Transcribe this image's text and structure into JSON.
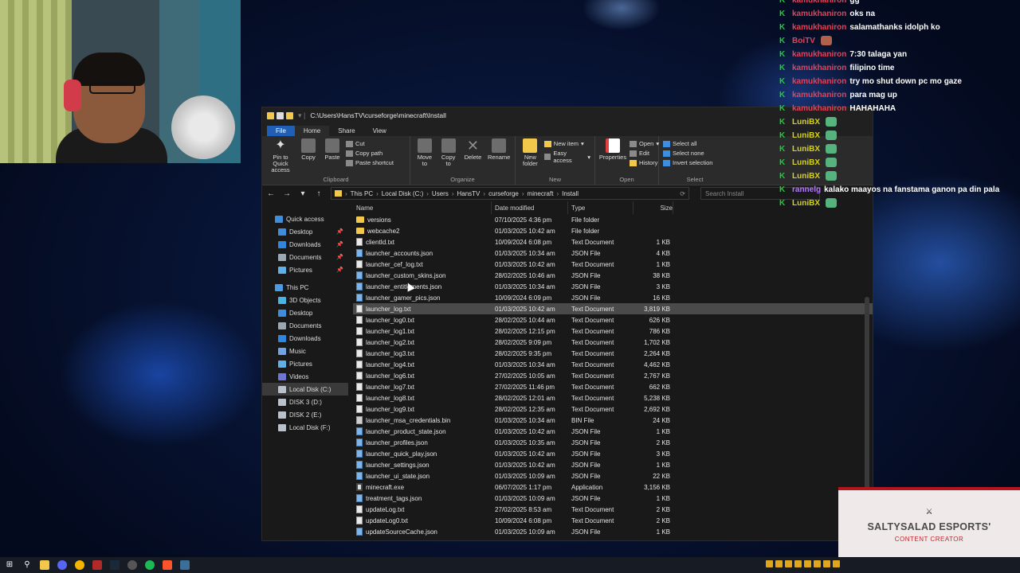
{
  "window": {
    "title": "C:\\Users\\HansTV\\curseforge\\minecraft\\Install",
    "ribbon_tabs": [
      "File",
      "Home",
      "Share",
      "View"
    ],
    "clipboard": {
      "pin_label": "Pin to Quick access",
      "copy_label": "Copy",
      "paste_label": "Paste",
      "cut_label": "Cut",
      "copy_path_label": "Copy path",
      "paste_shortcut_label": "Paste shortcut",
      "group_label": "Clipboard"
    },
    "organize": {
      "move_label": "Move to",
      "copy_label": "Copy to",
      "delete_label": "Delete",
      "rename_label": "Rename",
      "group_label": "Organize"
    },
    "new": {
      "new_folder_label": "New folder",
      "new_item_label": "New item",
      "easy_access_label": "Easy access",
      "group_label": "New"
    },
    "open": {
      "properties_label": "Properties",
      "open_label": "Open",
      "edit_label": "Edit",
      "history_label": "History",
      "group_label": "Open"
    },
    "select": {
      "select_all_label": "Select all",
      "select_none_label": "Select none",
      "invert_label": "Invert selection",
      "group_label": "Select"
    },
    "breadcrumb": [
      "This PC",
      "Local Disk (C:)",
      "Users",
      "HansTV",
      "curseforge",
      "minecraft",
      "Install"
    ],
    "search_placeholder": "Search Install",
    "nav": {
      "quick_access": "Quick access",
      "quick_items": [
        "Desktop",
        "Downloads",
        "Documents",
        "Pictures"
      ],
      "this_pc": "This PC",
      "pc_items": [
        "3D Objects",
        "Desktop",
        "Documents",
        "Downloads",
        "Music",
        "Pictures",
        "Videos",
        "Local Disk (C:)",
        "DISK 3 (D:)",
        "DISK 2 (E:)",
        "Local Disk (F:)"
      ]
    },
    "columns": {
      "name": "Name",
      "date": "Date modified",
      "type": "Type",
      "size": "Size"
    },
    "files": [
      {
        "name": "versions",
        "date": "07/10/2025 4:36 pm",
        "type": "File folder",
        "size": "",
        "icon": "folder"
      },
      {
        "name": "webcache2",
        "date": "01/03/2025 10:42 am",
        "type": "File folder",
        "size": "",
        "icon": "folder"
      },
      {
        "name": "clientId.txt",
        "date": "10/09/2024 6:08 pm",
        "type": "Text Document",
        "size": "1 KB",
        "icon": "txt"
      },
      {
        "name": "launcher_accounts.json",
        "date": "01/03/2025 10:34 am",
        "type": "JSON File",
        "size": "4 KB",
        "icon": "json"
      },
      {
        "name": "launcher_cef_log.txt",
        "date": "01/03/2025 10:42 am",
        "type": "Text Document",
        "size": "1 KB",
        "icon": "txt"
      },
      {
        "name": "launcher_custom_skins.json",
        "date": "28/02/2025 10:46 am",
        "type": "JSON File",
        "size": "38 KB",
        "icon": "json"
      },
      {
        "name": "launcher_entitlements.json",
        "date": "01/03/2025 10:34 am",
        "type": "JSON File",
        "size": "3 KB",
        "icon": "json"
      },
      {
        "name": "launcher_gamer_pics.json",
        "date": "10/09/2024 6:09 pm",
        "type": "JSON File",
        "size": "16 KB",
        "icon": "json"
      },
      {
        "name": "launcher_log.txt",
        "date": "01/03/2025 10:42 am",
        "type": "Text Document",
        "size": "3,819 KB",
        "icon": "txt"
      },
      {
        "name": "launcher_log0.txt",
        "date": "28/02/2025 10:44 am",
        "type": "Text Document",
        "size": "626 KB",
        "icon": "txt"
      },
      {
        "name": "launcher_log1.txt",
        "date": "28/02/2025 12:15 pm",
        "type": "Text Document",
        "size": "786 KB",
        "icon": "txt"
      },
      {
        "name": "launcher_log2.txt",
        "date": "28/02/2025 9:09 pm",
        "type": "Text Document",
        "size": "1,702 KB",
        "icon": "txt"
      },
      {
        "name": "launcher_log3.txt",
        "date": "28/02/2025 9:35 pm",
        "type": "Text Document",
        "size": "2,264 KB",
        "icon": "txt"
      },
      {
        "name": "launcher_log4.txt",
        "date": "01/03/2025 10:34 am",
        "type": "Text Document",
        "size": "4,462 KB",
        "icon": "txt"
      },
      {
        "name": "launcher_log6.txt",
        "date": "27/02/2025 10:05 am",
        "type": "Text Document",
        "size": "2,767 KB",
        "icon": "txt"
      },
      {
        "name": "launcher_log7.txt",
        "date": "27/02/2025 11:46 pm",
        "type": "Text Document",
        "size": "662 KB",
        "icon": "txt"
      },
      {
        "name": "launcher_log8.txt",
        "date": "28/02/2025 12:01 am",
        "type": "Text Document",
        "size": "5,238 KB",
        "icon": "txt"
      },
      {
        "name": "launcher_log9.txt",
        "date": "28/02/2025 12:35 am",
        "type": "Text Document",
        "size": "2,692 KB",
        "icon": "txt"
      },
      {
        "name": "launcher_msa_credentials.bin",
        "date": "01/03/2025 10:34 am",
        "type": "BIN File",
        "size": "24 KB",
        "icon": "bin"
      },
      {
        "name": "launcher_product_state.json",
        "date": "01/03/2025 10:42 am",
        "type": "JSON File",
        "size": "1 KB",
        "icon": "json"
      },
      {
        "name": "launcher_profiles.json",
        "date": "01/03/2025 10:35 am",
        "type": "JSON File",
        "size": "2 KB",
        "icon": "json"
      },
      {
        "name": "launcher_quick_play.json",
        "date": "01/03/2025 10:42 am",
        "type": "JSON File",
        "size": "3 KB",
        "icon": "json"
      },
      {
        "name": "launcher_settings.json",
        "date": "01/03/2025 10:42 am",
        "type": "JSON File",
        "size": "1 KB",
        "icon": "json"
      },
      {
        "name": "launcher_ui_state.json",
        "date": "01/03/2025 10:09 am",
        "type": "JSON File",
        "size": "22 KB",
        "icon": "json"
      },
      {
        "name": "minecraft.exe",
        "date": "06/07/2025 1:17 pm",
        "type": "Application",
        "size": "3,156 KB",
        "icon": "exe"
      },
      {
        "name": "treatment_tags.json",
        "date": "01/03/2025 10:09 am",
        "type": "JSON File",
        "size": "1 KB",
        "icon": "json"
      },
      {
        "name": "updateLog.txt",
        "date": "27/02/2025 8:53 am",
        "type": "Text Document",
        "size": "2 KB",
        "icon": "txt"
      },
      {
        "name": "updateLog0.txt",
        "date": "10/09/2024 6:08 pm",
        "type": "Text Document",
        "size": "2 KB",
        "icon": "txt"
      },
      {
        "name": "updateSourceCache.json",
        "date": "01/03/2025 10:09 am",
        "type": "JSON File",
        "size": "1 KB",
        "icon": "json"
      }
    ]
  },
  "chat": [
    {
      "user": "kamukhaniron",
      "color": "#e0445a",
      "text": "gg",
      "emote": ""
    },
    {
      "user": "kamukhaniron",
      "color": "#e0445a",
      "text": "oks na",
      "emote": ""
    },
    {
      "user": "kamukhaniron",
      "color": "#e0445a",
      "text": "salamathanks idolph ko",
      "emote": ""
    },
    {
      "user": "BoiTV",
      "color": "#e0445a",
      "text": "",
      "emote": "red",
      "indent": true
    },
    {
      "user": "kamukhaniron",
      "color": "#e0445a",
      "text": "7:30 talaga yan",
      "emote": ""
    },
    {
      "user": "kamukhaniron",
      "color": "#e0445a",
      "text": "filipino time",
      "emote": ""
    },
    {
      "user": "kamukhaniron",
      "color": "#e0445a",
      "text": "try mo shut down pc mo gaze",
      "emote": ""
    },
    {
      "user": "kamukhaniron",
      "color": "#e0445a",
      "text": "para mag up",
      "emote": ""
    },
    {
      "user": "kamukhaniron",
      "color": "#e0445a",
      "text": "HAHAHAHA",
      "emote": ""
    },
    {
      "user": "LuniBX",
      "color": "#d7d21a",
      "text": "",
      "emote": "green",
      "indent": true
    },
    {
      "user": "LuniBX",
      "color": "#d7d21a",
      "text": "",
      "emote": "green",
      "indent": true
    },
    {
      "user": "LuniBX",
      "color": "#d7d21a",
      "text": "",
      "emote": "green",
      "indent": true
    },
    {
      "user": "LuniBX",
      "color": "#d7d21a",
      "text": "",
      "emote": "green",
      "indent": true
    },
    {
      "user": "LuniBX",
      "color": "#d7d21a",
      "text": "",
      "emote": "green",
      "indent": true
    },
    {
      "user": "rannelg",
      "color": "#b07cf0",
      "text": "kalako maayos na fanstama ganon pa din pala",
      "emote": "",
      "indent": true
    },
    {
      "user": "LuniBX",
      "color": "#d7d21a",
      "text": "",
      "emote": "green"
    }
  ],
  "brand": {
    "name": "SALTYSALAD ESPORTS'",
    "tagline": "CONTENT CREATOR"
  },
  "colors": {
    "accent": "#1f5fb5",
    "brand_red": "#b4141d",
    "folder": "#f2c84b",
    "mod_badge": "#1fcf3a"
  }
}
